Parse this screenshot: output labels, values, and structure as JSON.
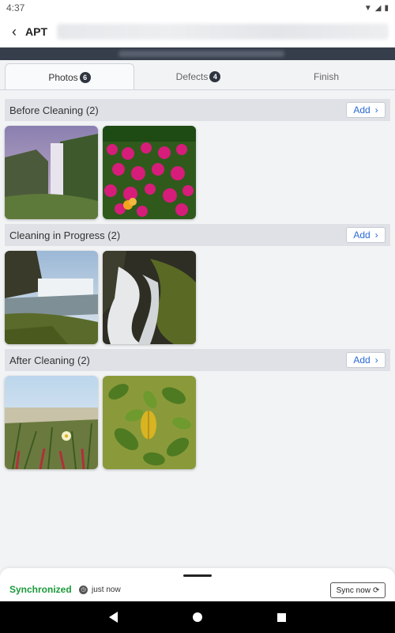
{
  "status_bar": {
    "time": "4:37"
  },
  "header": {
    "title": "APT"
  },
  "tabs": [
    {
      "label": "Photos",
      "badge": "6"
    },
    {
      "label": "Defects",
      "badge": "4"
    },
    {
      "label": "Finish"
    }
  ],
  "sections": [
    {
      "title": "Before Cleaning (2)",
      "add_label": "Add",
      "photos": [
        "waterfall-cliff",
        "pink-flowers"
      ]
    },
    {
      "title": "Cleaning in Progress (2)",
      "add_label": "Add",
      "photos": [
        "waterfall-river",
        "cascade-rocks"
      ]
    },
    {
      "title": "After Cleaning (2)",
      "add_label": "Add",
      "photos": [
        "beach-grass-flower",
        "green-leaves"
      ]
    }
  ],
  "footer": {
    "sync_status": "Synchronized",
    "sync_time": "just now",
    "sync_button": "Sync now"
  },
  "colors": {
    "accent": "#2a6ad6",
    "synced": "#1a9a3a",
    "dark_band": "#353e4a"
  }
}
